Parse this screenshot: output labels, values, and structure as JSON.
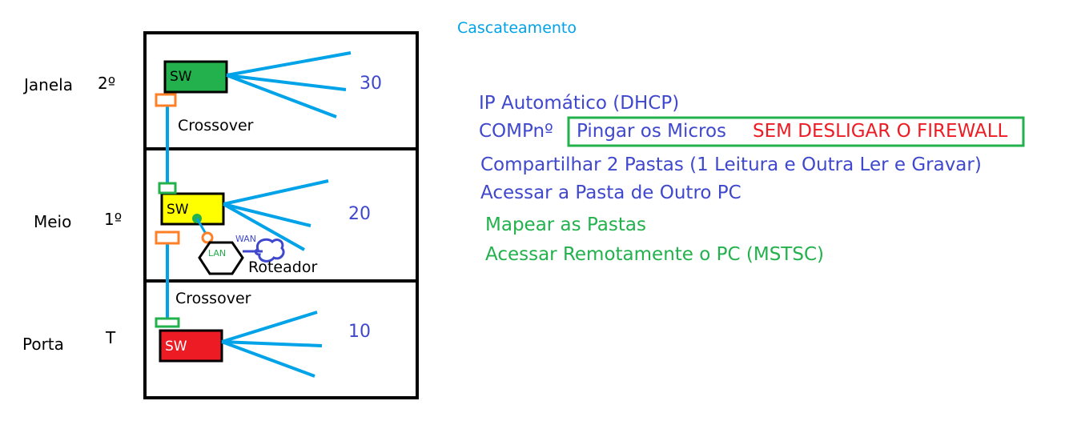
{
  "title": "Cascateamento",
  "floors": [
    {
      "name": "Janela",
      "level": "2º",
      "count": "30"
    },
    {
      "name": "Meio",
      "level": "1º",
      "count": "20"
    },
    {
      "name": "Porta",
      "level": "T",
      "count": "10"
    }
  ],
  "switch_label": "SW",
  "cable_labels": [
    "Crossover",
    "Crossover"
  ],
  "router": {
    "lan": "LAN",
    "wan": "WAN",
    "name": "Roteador"
  },
  "tasks": {
    "ip": "IP Automático (DHCP)",
    "comp": "COMPnº",
    "ping": "Pingar os Micros",
    "firewall": "SEM DESLIGAR O FIREWALL",
    "share": "Compartilhar 2 Pastas (1 Leitura e Outra Ler e Gravar)",
    "access": "Acessar a Pasta de Outro PC",
    "map": "Mapear as Pastas",
    "remote": "Acessar Remotamente o PC (MSTSC)"
  },
  "colors": {
    "sw_top": "#22b14c",
    "sw_mid": "#ffff00",
    "sw_bottom": "#ed1c24",
    "cable": "#00a2e8",
    "connector_orange": "#ff7f27",
    "connector_green": "#22b14c",
    "text_blue": "#3f48cc",
    "text_green": "#22b14c",
    "text_red": "#ed1c24",
    "title": "#00a2e8"
  }
}
